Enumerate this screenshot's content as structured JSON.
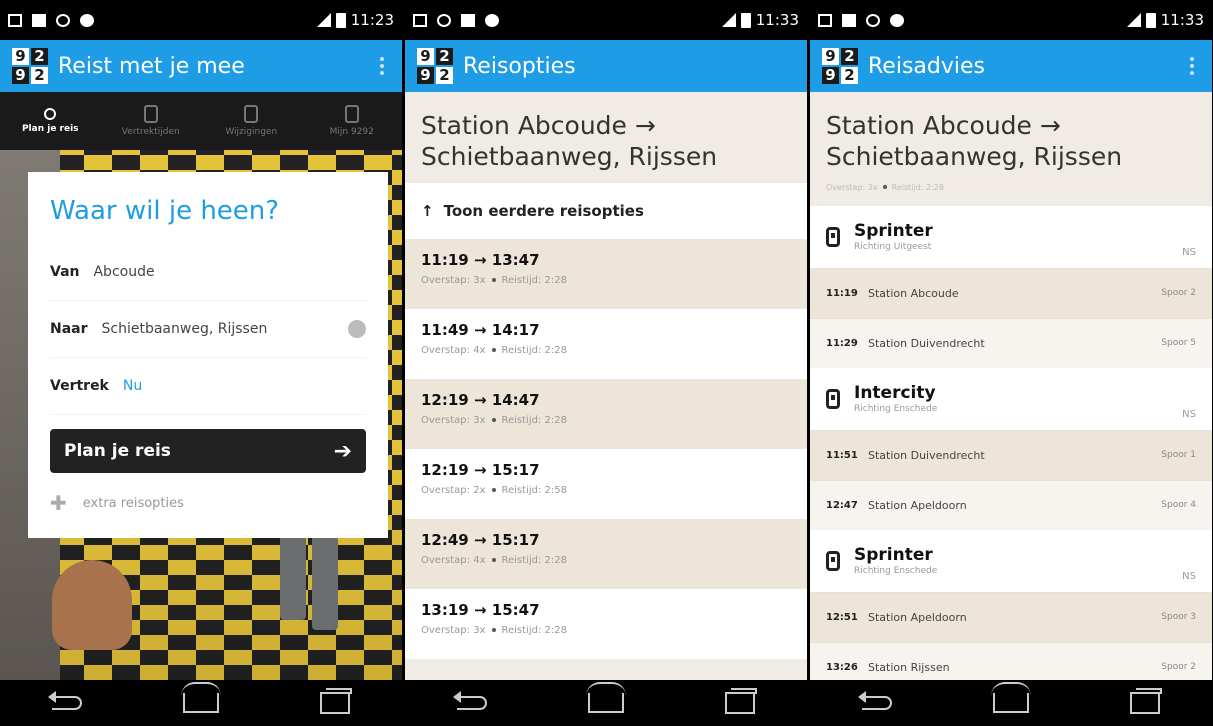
{
  "phone1": {
    "status_time": "11:23",
    "title": "Reist met je mee",
    "tabs": [
      "Plan je reis",
      "Vertrektijden",
      "Wijzigingen",
      "Mijn 9292"
    ],
    "card": {
      "heading": "Waar wil je heen?",
      "van_label": "Van",
      "van_value": "Abcoude",
      "naar_label": "Naar",
      "naar_value": "Schietbaanweg, Rijssen",
      "vertrek_label": "Vertrek",
      "vertrek_value": "Nu",
      "plan_button": "Plan je reis",
      "extra": "extra reisopties"
    }
  },
  "phone2": {
    "status_time": "11:33",
    "title": "Reisopties",
    "headline_line1": "Station Abcoude →",
    "headline_line2": "Schietbaanweg, Rijssen",
    "earlier": "Toon eerdere reisopties",
    "options": [
      {
        "time": "11:19 → 13:47",
        "transfer": "Overstap: 3x",
        "duration": "Reistijd: 2:28"
      },
      {
        "time": "11:49 → 14:17",
        "transfer": "Overstap: 4x",
        "duration": "Reistijd: 2:28"
      },
      {
        "time": "12:19 → 14:47",
        "transfer": "Overstap: 3x",
        "duration": "Reistijd: 2:28"
      },
      {
        "time": "12:19 → 15:17",
        "transfer": "Overstap: 2x",
        "duration": "Reistijd: 2:58"
      },
      {
        "time": "12:49 → 15:17",
        "transfer": "Overstap: 4x",
        "duration": "Reistijd: 2:28"
      },
      {
        "time": "13:19 → 15:47",
        "transfer": "Overstap: 3x",
        "duration": "Reistijd: 2:28"
      }
    ]
  },
  "phone3": {
    "status_time": "11:33",
    "title": "Reisadvies",
    "headline_line1": "Station Abcoude →",
    "headline_line2": "Schietbaanweg, Rijssen",
    "sub_transfer": "Overstap: 3x",
    "sub_duration": "Reistijd: 2:28",
    "legs": [
      {
        "name": "Sprinter",
        "direction": "Richting Uitgeest",
        "operator": "NS",
        "stops": [
          {
            "time": "11:19",
            "station": "Station Abcoude",
            "platform": "Spoor 2"
          },
          {
            "time": "11:29",
            "station": "Station Duivendrecht",
            "platform": "Spoor 5"
          }
        ]
      },
      {
        "name": "Intercity",
        "direction": "Richting Enschede",
        "operator": "NS",
        "stops": [
          {
            "time": "11:51",
            "station": "Station Duivendrecht",
            "platform": "Spoor 1"
          },
          {
            "time": "12:47",
            "station": "Station Apeldoorn",
            "platform": "Spoor 4"
          }
        ]
      },
      {
        "name": "Sprinter",
        "direction": "Richting Enschede",
        "operator": "NS",
        "stops": [
          {
            "time": "12:51",
            "station": "Station Apeldoorn",
            "platform": "Spoor 3"
          },
          {
            "time": "13:26",
            "station": "Station Rijssen",
            "platform": "Spoor 2"
          }
        ]
      }
    ]
  },
  "colors": {
    "accent": "#1e9de6",
    "dark": "#1a1a1a",
    "beige": "#ece5d8"
  }
}
